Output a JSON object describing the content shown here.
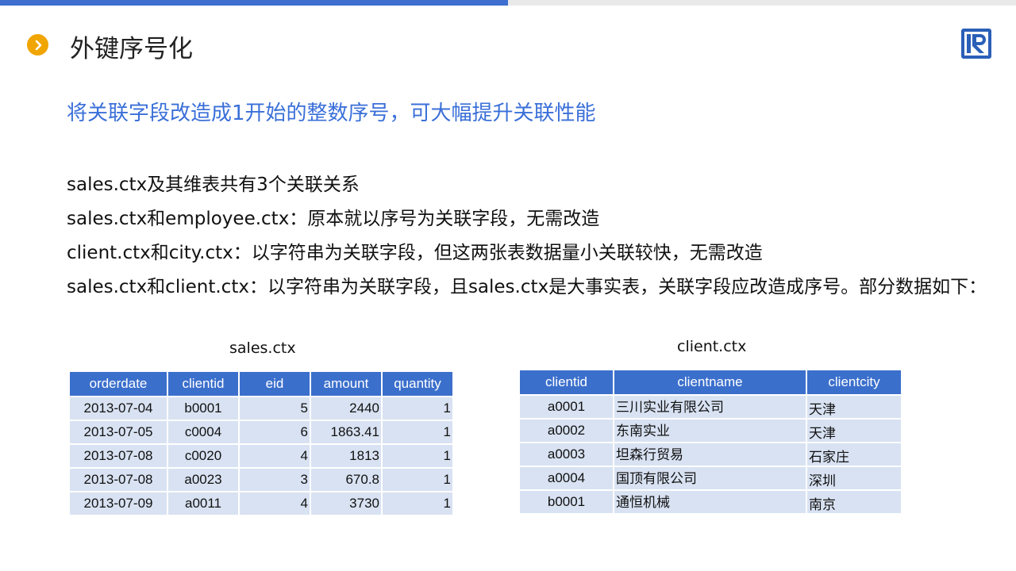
{
  "title": "外键序号化",
  "subtitle": "将关联字段改造成1开始的整数序号，可大幅提升关联性能",
  "paragraphs": [
    "sales.ctx及其维表共有3个关联关系",
    "sales.ctx和employee.ctx：原本就以序号为关联字段，无需改造",
    "client.ctx和city.ctx：以字符串为关联字段，但这两张表数据量小关联较快，无需改造",
    "sales.ctx和client.ctx：以字符串为关联字段，且sales.ctx是大事实表，关联字段应改造成序号。部分数据如下："
  ],
  "sales_table": {
    "caption": "sales.ctx",
    "headers": [
      "orderdate",
      "clientid",
      "eid",
      "amount",
      "quantity"
    ],
    "rows": [
      [
        "2013-07-04",
        "b0001",
        "5",
        "2440",
        "1"
      ],
      [
        "2013-07-05",
        "c0004",
        "6",
        "1863.41",
        "1"
      ],
      [
        "2013-07-08",
        "c0020",
        "4",
        "1813",
        "1"
      ],
      [
        "2013-07-08",
        "a0023",
        "3",
        "670.8",
        "1"
      ],
      [
        "2013-07-09",
        "a0011",
        "4",
        "3730",
        "1"
      ]
    ]
  },
  "client_table": {
    "caption": "client.ctx",
    "headers": [
      "clientid",
      "clientname",
      "clientcity"
    ],
    "rows": [
      [
        "a0001",
        "三川实业有限公司",
        "天津"
      ],
      [
        "a0002",
        "东南实业",
        "天津"
      ],
      [
        "a0003",
        "坦森行贸易",
        "石家庄"
      ],
      [
        "a0004",
        "国顶有限公司",
        "深圳"
      ],
      [
        "b0001",
        "通恒机械",
        "南京"
      ]
    ]
  },
  "colors": {
    "accent": "#3e6ecf",
    "header_bg": "#3b6fcc",
    "cell_bg": "#d8e2f2",
    "bullet": "#f0a500",
    "subtitle": "#3a6fd8"
  },
  "icons": {
    "bullet": "chevron-right-icon",
    "logo": "logo-r-icon"
  }
}
